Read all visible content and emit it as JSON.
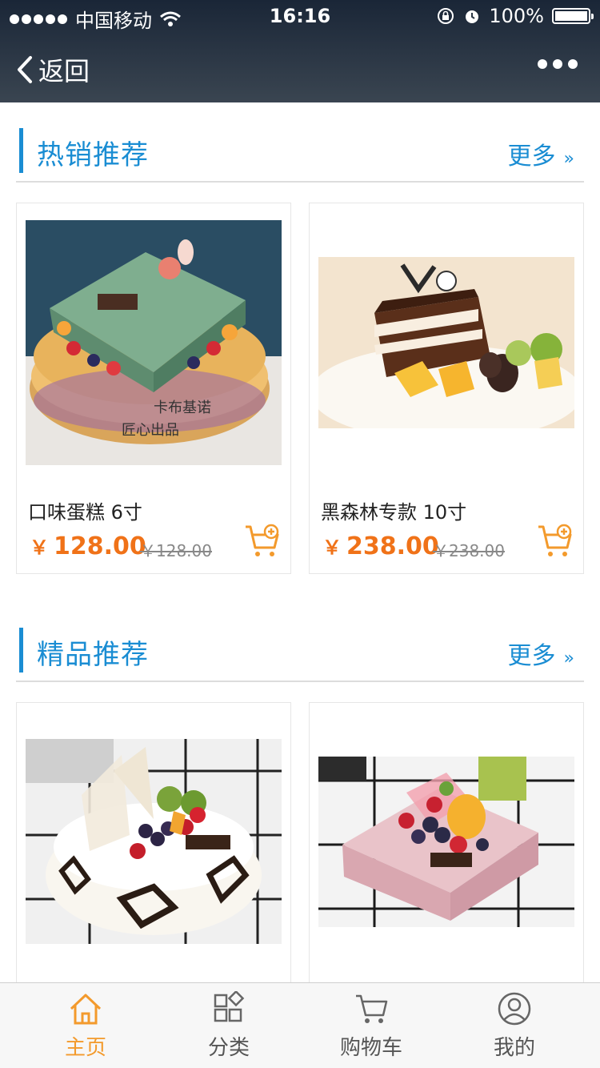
{
  "status_bar": {
    "carrier": "中国移动",
    "time": "16:16",
    "battery": "100%"
  },
  "nav": {
    "back_label": "返回"
  },
  "sections": [
    {
      "title": "热销推荐",
      "more": "更多",
      "products": [
        {
          "name": "口味蛋糕 6寸",
          "price": "128.00",
          "old_price": "￥128.00",
          "yen": "￥"
        },
        {
          "name": "黑森林专款 10寸",
          "price": "238.00",
          "old_price": "￥238.00",
          "yen": "￥"
        }
      ]
    },
    {
      "title": "精品推荐",
      "more": "更多",
      "products": [
        {
          "name": "",
          "price": "",
          "old_price": ""
        },
        {
          "name": "",
          "price": "",
          "old_price": ""
        }
      ]
    }
  ],
  "tabbar": {
    "items": [
      {
        "label": "主页",
        "icon": "home-icon",
        "active": true
      },
      {
        "label": "分类",
        "icon": "grid-icon",
        "active": false
      },
      {
        "label": "购物车",
        "icon": "cart-icon",
        "active": false
      },
      {
        "label": "我的",
        "icon": "user-icon",
        "active": false
      }
    ],
    "active_color": "#f39a2c"
  },
  "colors": {
    "accent": "#1a8dd3",
    "price": "#f07218"
  }
}
